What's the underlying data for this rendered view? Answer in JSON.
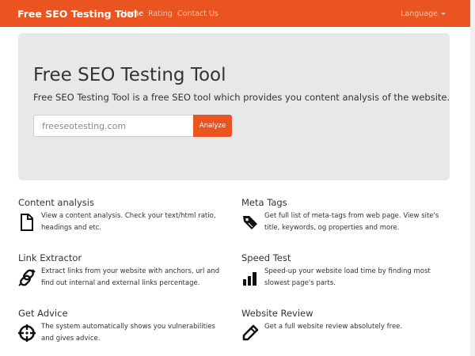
{
  "navbar": {
    "brand": "Free SEO Testing Tool",
    "links": [
      {
        "label": "Home",
        "active": true
      },
      {
        "label": "Rating",
        "active": false
      },
      {
        "label": "Contact Us",
        "active": false
      }
    ],
    "language_label": "Language",
    "accent_color": "#e95420"
  },
  "hero": {
    "title": "Free SEO Testing Tool",
    "subtitle": "Free SEO Testing Tool is a free SEO tool which provides you content analysis of the website.",
    "search": {
      "placeholder": "freeseotesting.com",
      "value": ""
    },
    "analyze_label": "Analyze"
  },
  "features": [
    {
      "title": "Content analysis",
      "text": "View a content analysis. Check your text/html ratio, headings and etc.",
      "icon": "file-icon"
    },
    {
      "title": "Meta Tags",
      "text": "Get full list of meta-tags from web page. View site's title, keywords, og properties and more.",
      "icon": "tag-icon"
    },
    {
      "title": "Link Extractor",
      "text": "Extract links from your website with anchors, url and find out internal and external links percentage.",
      "icon": "link-icon"
    },
    {
      "title": "Speed Test",
      "text": "Speed-up your website load time by finding most slowest page's parts.",
      "icon": "signal-icon"
    },
    {
      "title": "Get Advice",
      "text": "The system automatically shows you vulnerabilities and gives advice.",
      "icon": "crosshair-icon"
    },
    {
      "title": "Website Review",
      "text": "Get a full website review absolutely free.",
      "icon": "pencil-icon"
    }
  ]
}
